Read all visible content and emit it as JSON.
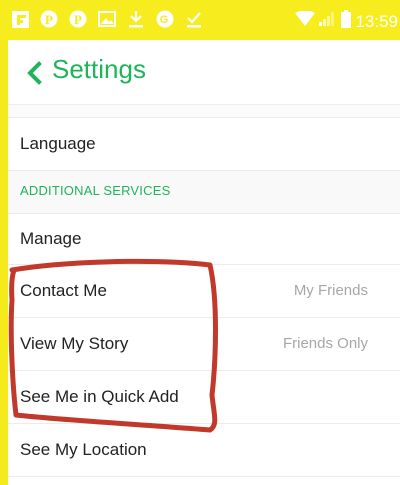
{
  "status_bar": {
    "time": "13:59",
    "icons": [
      "flipboard-icon",
      "pinterest-icon",
      "pinterest-icon",
      "image-icon",
      "download-icon",
      "google-plus-icon",
      "check-icon"
    ]
  },
  "header": {
    "title": "Settings",
    "accent_color": "#1fb45a"
  },
  "rows": {
    "language": {
      "label": "Language"
    },
    "section": {
      "label": "ADDITIONAL SERVICES"
    },
    "manage": {
      "label": "Manage"
    },
    "contact_me": {
      "label": "Contact Me",
      "value": "My Friends"
    },
    "view_my_story": {
      "label": "View My Story",
      "value": "Friends Only"
    },
    "see_me_quick_add": {
      "label": "See Me in Quick Add"
    },
    "see_my_location": {
      "label": "See My Location"
    }
  },
  "annotation": {
    "color": "#c0392b",
    "description_shape": "hand-drawn-loop"
  }
}
